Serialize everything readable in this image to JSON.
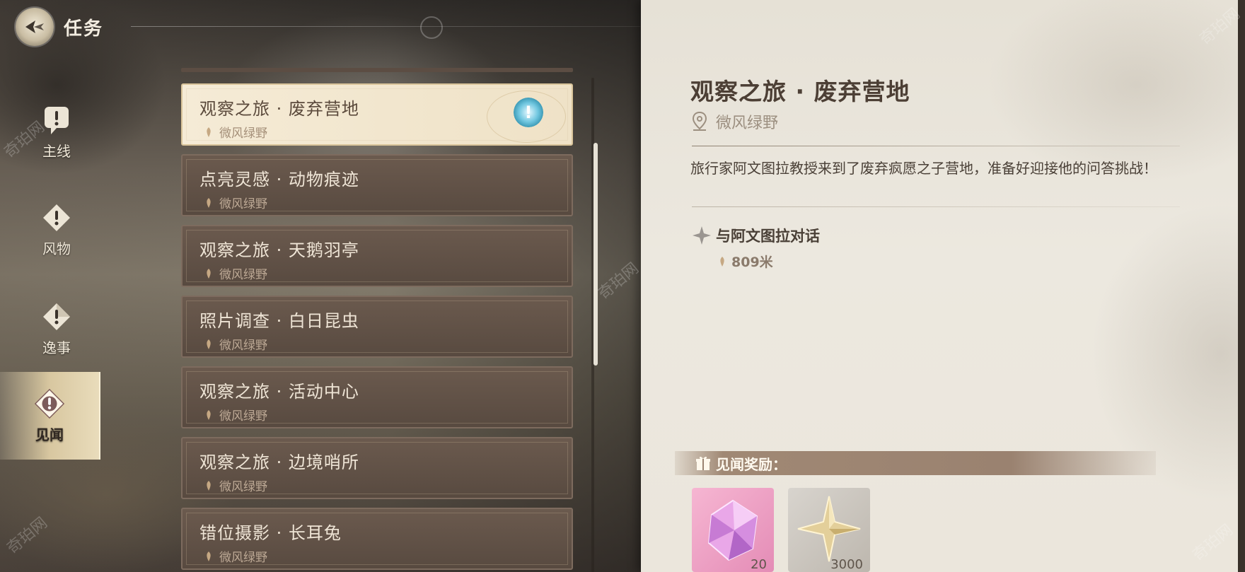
{
  "header": {
    "title": "任务"
  },
  "categories": [
    {
      "label": "主线",
      "active": false
    },
    {
      "label": "风物",
      "active": false
    },
    {
      "label": "逸事",
      "active": false
    },
    {
      "label": "见闻",
      "active": true
    }
  ],
  "quests": [
    {
      "title": "观察之旅 · 废弃营地",
      "location": "微风绿野",
      "selected": true
    },
    {
      "title": "点亮灵感 · 动物痕迹",
      "location": "微风绿野"
    },
    {
      "title": "观察之旅 · 天鹅羽亭",
      "location": "微风绿野"
    },
    {
      "title": "照片调查 · 白日昆虫",
      "location": "微风绿野"
    },
    {
      "title": "观察之旅 · 活动中心",
      "location": "微风绿野"
    },
    {
      "title": "观察之旅 · 边境哨所",
      "location": "微风绿野"
    },
    {
      "title": "错位摄影 · 长耳兔",
      "location": "微风绿野"
    }
  ],
  "detail": {
    "title": "观察之旅 · 废弃营地",
    "location": "微风绿野",
    "description": "旅行家阿文图拉教授来到了废弃疯愿之子营地，准备好迎接他的问答挑战！",
    "objective": "与阿文图拉对话",
    "distance": "809米",
    "reward_label": "见闻奖励：",
    "rewards": [
      {
        "count": "20",
        "icon": "pink-crystal-icon",
        "bg": "#f1a6c9"
      },
      {
        "count": "3000",
        "icon": "gold-star-icon",
        "bg": "#c9c4bd"
      }
    ]
  },
  "watermark": "奇珀网",
  "colors": {
    "accent_blue": "#5fb9d6",
    "panel_brown": "#5e4e43",
    "paper": "#ebe6dc"
  }
}
